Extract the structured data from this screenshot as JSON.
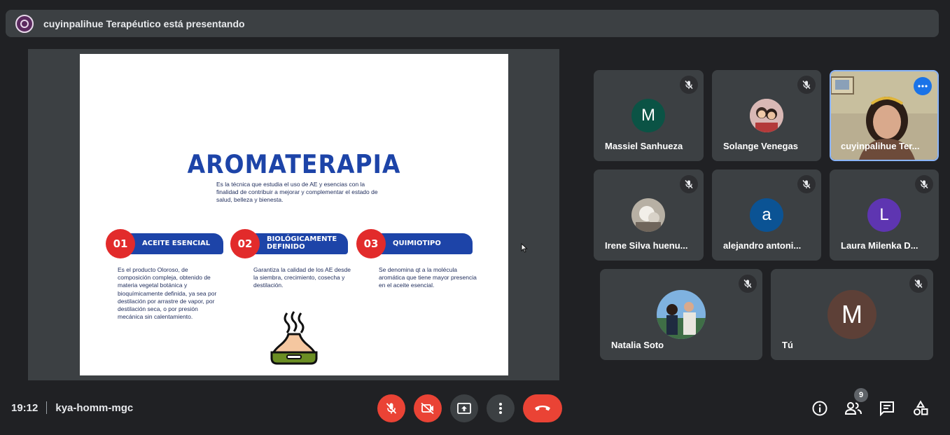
{
  "banner": {
    "text": "cuyinpalihue Terapéutico está presentando"
  },
  "slide": {
    "title": "AROMATERAPIA",
    "intro": "Es la técnica que estudia el uso de AE y esencias con la finalidad de contribuir a mejorar y complementar el estado de salud, belleza y bienesta.",
    "items": [
      {
        "num": "01",
        "label": "ACEITE ESENCIAL",
        "desc": "Es el producto Oloroso, de composición compleja, obtenido de materia vegetal botánica y bioquímicamente definida, ya sea por destilación por arrastre de vapor, por destilación seca, o por presión mecánica sin calentamiento."
      },
      {
        "num": "02",
        "label": "BIOLÓGICAMENTE DEFINIDO",
        "desc": "Garantiza la calidad de los AE desde la siembra, crecimiento, cosecha y destilación."
      },
      {
        "num": "03",
        "label": "QUIMIOTIPO",
        "desc": "Se denomina qt a la molécula aromática que tiene mayor presencia en el aceite esencial."
      }
    ]
  },
  "participants": [
    {
      "name": "Massiel Sanhueza",
      "initial": "M",
      "color": "#0b5345"
    },
    {
      "name": "Solange Venegas",
      "initial": "",
      "color": "#c9a3a6"
    },
    {
      "name": "cuyinpalihue Ter...",
      "initial": "",
      "color": "#8a7a5e"
    },
    {
      "name": "Irene Silva huenu...",
      "initial": "",
      "color": "#7c776f"
    },
    {
      "name": "alejandro antoni...",
      "initial": "a",
      "color": "#0b5394"
    },
    {
      "name": "Laura Milenka D...",
      "initial": "L",
      "color": "#5e35b1"
    },
    {
      "name": "Natalia Soto",
      "initial": "",
      "color": "#5b8fc4"
    },
    {
      "name": "Tú",
      "initial": "M",
      "color": "#5d4037"
    }
  ],
  "meeting": {
    "time": "19:12",
    "code": "kya-homm-mgc",
    "people_count": "9"
  },
  "colors": {
    "end_call": "#ea4335",
    "tile_bg": "#3c4043",
    "active_border": "#8ab4f8"
  }
}
